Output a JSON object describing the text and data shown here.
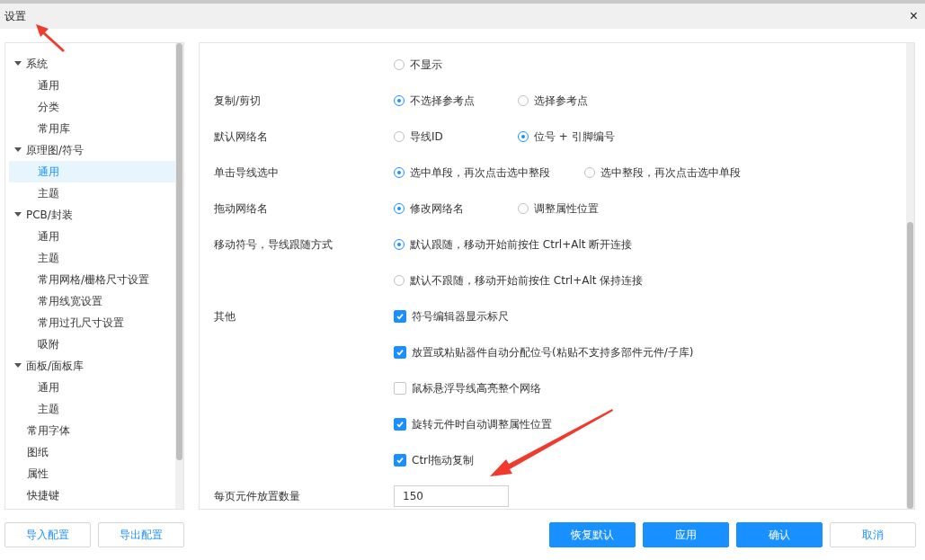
{
  "window": {
    "title": "设置",
    "close": "×"
  },
  "sidebar": {
    "items": [
      {
        "label": "系统",
        "expanded": true,
        "selected": false,
        "children": [
          {
            "label": "通用",
            "selected": false
          },
          {
            "label": "分类",
            "selected": false
          },
          {
            "label": "常用库",
            "selected": false
          }
        ]
      },
      {
        "label": "原理图/符号",
        "expanded": true,
        "selected": false,
        "children": [
          {
            "label": "通用",
            "selected": true
          },
          {
            "label": "主题",
            "selected": false
          }
        ]
      },
      {
        "label": "PCB/封装",
        "expanded": true,
        "selected": false,
        "children": [
          {
            "label": "通用",
            "selected": false
          },
          {
            "label": "主题",
            "selected": false
          },
          {
            "label": "常用网格/栅格尺寸设置",
            "selected": false
          },
          {
            "label": "常用线宽设置",
            "selected": false
          },
          {
            "label": "常用过孔尺寸设置",
            "selected": false
          },
          {
            "label": "吸附",
            "selected": false
          }
        ]
      },
      {
        "label": "面板/面板库",
        "expanded": true,
        "selected": false,
        "children": [
          {
            "label": "通用",
            "selected": false
          },
          {
            "label": "主题",
            "selected": false
          }
        ]
      },
      {
        "label": "常用字体",
        "selected": false
      },
      {
        "label": "图纸",
        "selected": false
      },
      {
        "label": "属性",
        "selected": false
      },
      {
        "label": "快捷键",
        "selected": false
      }
    ]
  },
  "settings": [
    {
      "kind": "radio",
      "options": [
        {
          "label": "不显示",
          "selected": false
        }
      ]
    },
    {
      "kind": "radio",
      "label": "复制/剪切",
      "options": [
        {
          "label": "不选择参考点",
          "selected": true
        },
        {
          "label": "选择参考点",
          "selected": false
        }
      ]
    },
    {
      "kind": "radio",
      "label": "默认网络名",
      "options": [
        {
          "label": "导线ID",
          "selected": false
        },
        {
          "label": "位号 + 引脚编号",
          "selected": true
        }
      ]
    },
    {
      "kind": "radio",
      "label": "单击导线选中",
      "options": [
        {
          "label": "选中单段，再次点击选中整段",
          "selected": true
        },
        {
          "label": "选中整段，再次点击选中单段",
          "selected": false
        }
      ]
    },
    {
      "kind": "radio",
      "label": "拖动网络名",
      "options": [
        {
          "label": "修改网络名",
          "selected": true
        },
        {
          "label": "调整属性位置",
          "selected": false
        }
      ]
    },
    {
      "kind": "radio",
      "label": "移动符号，导线跟随方式",
      "stacked": true,
      "options": [
        {
          "label": "默认跟随，移动开始前按住 Ctrl+Alt 断开连接",
          "selected": true
        },
        {
          "label": "默认不跟随，移动开始前按住 Ctrl+Alt 保持连接",
          "selected": false
        }
      ]
    },
    {
      "kind": "checkbox",
      "label": "其他",
      "stacked": true,
      "options": [
        {
          "label": "符号编辑器显示标尺",
          "checked": true
        },
        {
          "label": "放置或粘贴器件自动分配位号(粘贴不支持多部件元件/子库)",
          "checked": true
        },
        {
          "label": "鼠标悬浮导线高亮整个网络",
          "checked": false
        },
        {
          "label": "旋转元件时自动调整属性位置",
          "checked": true
        },
        {
          "label": "Ctrl拖动复制",
          "checked": true
        }
      ]
    },
    {
      "kind": "input",
      "label": "每页元件放置数量",
      "value": "150"
    }
  ],
  "footer_left": [
    "导入配置",
    "导出配置"
  ],
  "footer_right": [
    {
      "label": "恢复默认",
      "primary": true
    },
    {
      "label": "应用",
      "primary": true
    },
    {
      "label": "确认",
      "primary": true
    },
    {
      "label": "取消",
      "primary": false
    }
  ]
}
